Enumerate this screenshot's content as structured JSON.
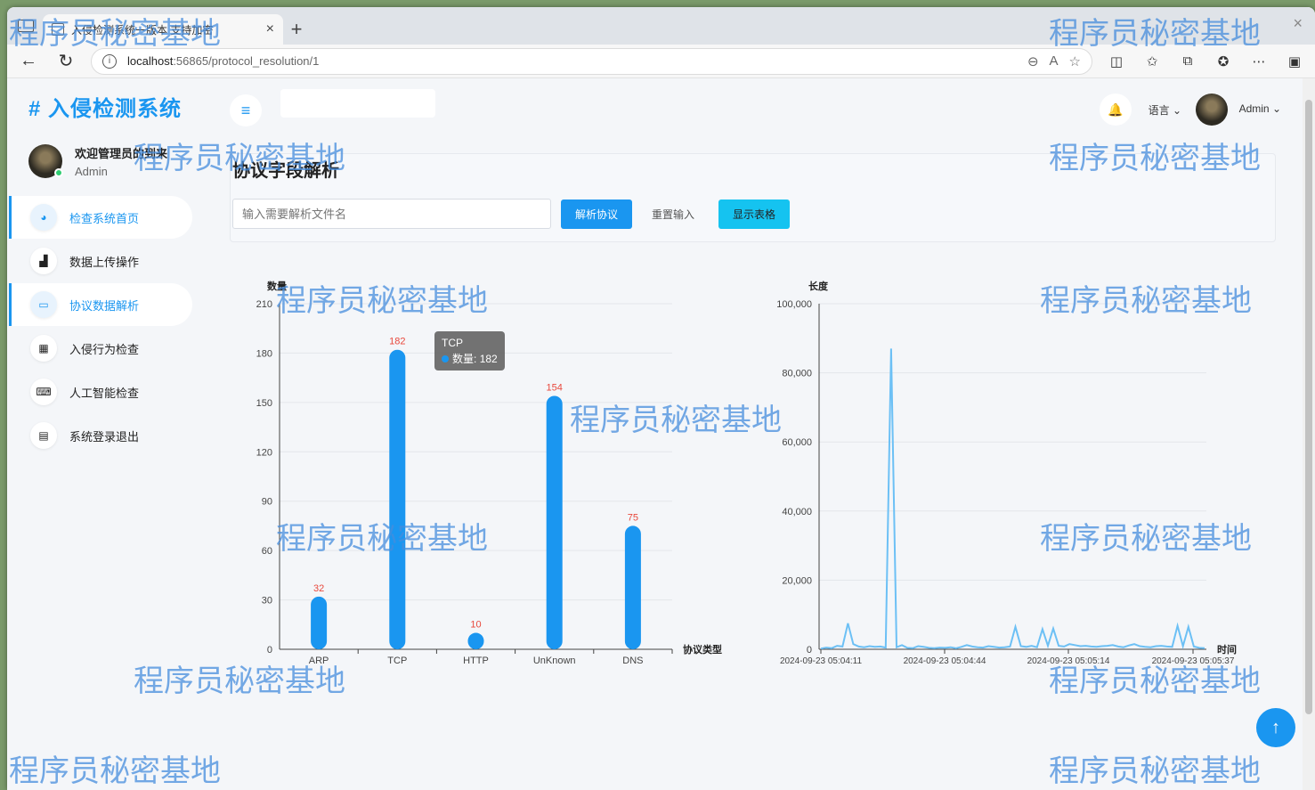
{
  "browser": {
    "tab_title": "入侵检测系统一版本 支持加密",
    "url_host": "localhost",
    "url_rest": ":56865/protocol_resolution/1"
  },
  "app": {
    "brand": "# 入侵检测系统",
    "welcome": "欢迎管理员的到来",
    "role": "Admin",
    "lang": "语言 ⌄",
    "admin": "Admin ⌄"
  },
  "menu": [
    {
      "label": "检查系统首页",
      "icon": "dashboard-icon",
      "glyph": "◕",
      "active": true
    },
    {
      "label": "数据上传操作",
      "icon": "bar-chart-icon",
      "glyph": "▟",
      "active": false
    },
    {
      "label": "协议数据解析",
      "icon": "laptop-icon",
      "glyph": "▭",
      "active": true
    },
    {
      "label": "入侵行为检查",
      "icon": "grid-icon",
      "glyph": "▦",
      "active": false
    },
    {
      "label": "人工智能检查",
      "icon": "keyboard-icon",
      "glyph": "⌨",
      "active": false
    },
    {
      "label": "系统登录退出",
      "icon": "document-icon",
      "glyph": "▤",
      "active": false
    }
  ],
  "page": {
    "title": "协议字段解析",
    "file_placeholder": "输入需要解析文件名",
    "parse_label": "解析协议",
    "reset_label": "重置输入",
    "table_label": "显示表格"
  },
  "chart_data": [
    {
      "type": "bar",
      "ylabel": "数量",
      "xlabel": "协议类型",
      "categories": [
        "ARP",
        "TCP",
        "HTTP",
        "UnKnown",
        "DNS"
      ],
      "values": [
        32,
        182,
        10,
        154,
        75
      ],
      "ylim": [
        0,
        210
      ],
      "yticks": [
        0,
        30,
        60,
        90,
        120,
        150,
        180,
        210
      ],
      "color": "#1a96f0",
      "label_color": "#e8483c",
      "tooltip": {
        "title": "TCP",
        "series": "数量",
        "value": 182
      }
    },
    {
      "type": "line",
      "ylabel": "长度",
      "xlabel": "时间",
      "ylim": [
        0,
        100000
      ],
      "yticks": [
        0,
        20000,
        40000,
        60000,
        80000,
        100000
      ],
      "ytick_labels": [
        "0",
        "20,000",
        "40,000",
        "60,000",
        "80,000",
        "100,000"
      ],
      "xtick_labels": [
        "2024-09-23 05:04:11",
        "2024-09-23 05:04:44",
        "2024-09-23 05:05:14",
        "2024-09-23 05:05:37"
      ],
      "color": "#6cc0f5",
      "values": [
        200,
        500,
        300,
        1000,
        800,
        7500,
        1500,
        800,
        600,
        900,
        700,
        800,
        500,
        87000,
        600,
        1200,
        400,
        300,
        900,
        700,
        400,
        300,
        500,
        400,
        600,
        300,
        700,
        1200,
        800,
        600,
        500,
        900,
        700,
        500,
        600,
        800,
        6500,
        900,
        700,
        1000,
        600,
        5800,
        1000,
        6000,
        1000,
        800,
        1500,
        1200,
        900,
        1000,
        800,
        700,
        900,
        1000,
        1200,
        800,
        600,
        1100,
        1500,
        900,
        700,
        600,
        900,
        1000,
        800,
        700,
        6800,
        900,
        6500,
        800,
        400,
        300
      ]
    }
  ],
  "watermark": "程序员秘密基地"
}
